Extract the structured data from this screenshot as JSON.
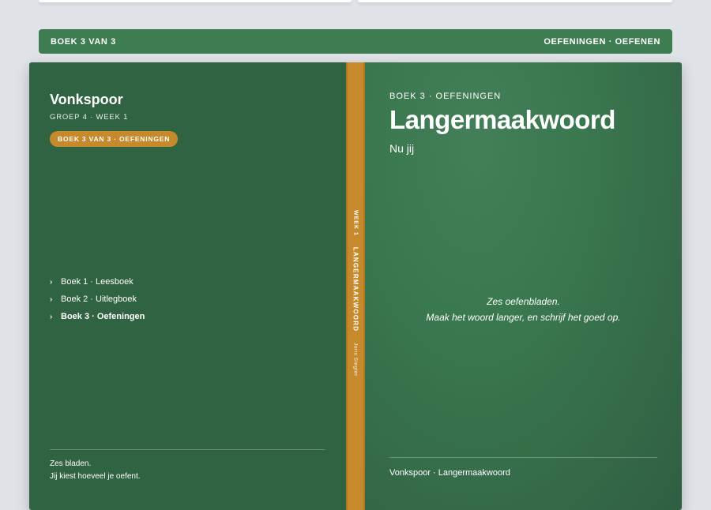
{
  "header": {
    "left_label": "BOEK 3 VAN 3",
    "right_label": "OEFENINGEN · OEFENEN"
  },
  "back_cover": {
    "title": "Vonkspoor",
    "subtitle": "GROEP 4 · WEEK 1",
    "badge": "BOEK 3 VAN 3 · OEFENINGEN",
    "toc": [
      {
        "label": "Boek 1 · Leesboek",
        "icon": "chevron-right-icon"
      },
      {
        "label": "Boek 2 · Uitlegboek",
        "icon": "chevron-right-icon"
      },
      {
        "label": "Boek 3 · Oefeningen",
        "icon": "chevron-right-icon",
        "active": true
      }
    ],
    "footer_line1": "Zes bladen.",
    "footer_line2": "Jij kiest hoeveel je oefent."
  },
  "spine": {
    "week": "WEEK 1",
    "title": "LANGERMAAKWOORD",
    "author": "Joris Slegter"
  },
  "front_cover": {
    "kicker": "BOEK 3 · OEFENINGEN",
    "title": "Langermaakwoord",
    "subtitle": "Nu jij",
    "blurb_line1": "Zes oefenbladen.",
    "blurb_line2": "Maak het woord langer, en schrijf het goed op.",
    "footer": "Vonkspoor · Langermaakwoord"
  },
  "colors": {
    "background": "#dfe2e6",
    "header_green": "#3d7d51",
    "cover_green": "#2f6341",
    "spine_orange": "#c68a2c"
  }
}
